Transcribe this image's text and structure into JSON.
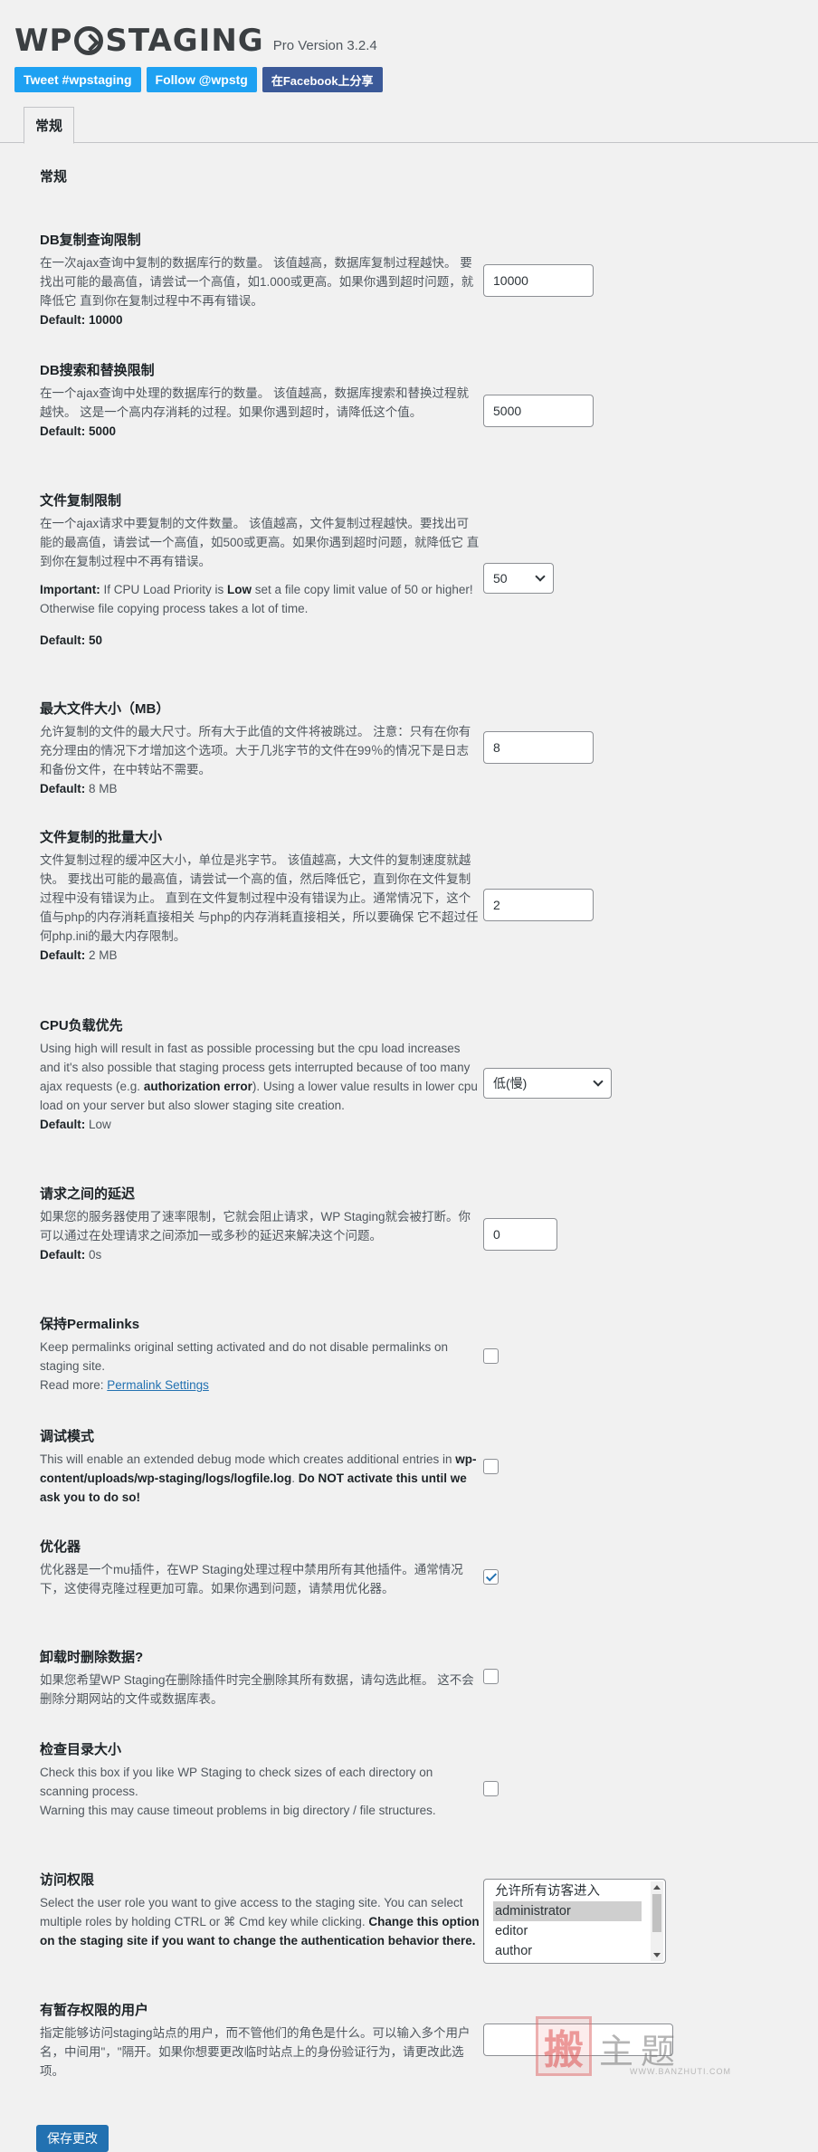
{
  "header": {
    "logo_text_left": "WP",
    "logo_text_right": "STAGING",
    "version": "Pro Version 3.2.4",
    "social": {
      "tweet": "Tweet #wpstaging",
      "follow": "Follow @wpstg",
      "facebook": "在Facebook上分享"
    },
    "tab": "常规"
  },
  "section_title": "常规",
  "settings": {
    "db_copy_limit": {
      "title": "DB复制查询限制",
      "desc": "在一次ajax查询中复制的数据库行的数量。 该值越高，数据库复制过程越快。 要找出可能的最高值，请尝试一个高值，如1.000或更高。如果你遇到超时问题，就降低它 直到你在复制过程中不再有错误。",
      "default_label": "Default:",
      "default_value": "10000",
      "value": "10000"
    },
    "db_search_replace": {
      "title": "DB搜索和替换限制",
      "desc": "在一个ajax查询中处理的数据库行的数量。 该值越高，数据库搜索和替换过程就越快。 这是一个高内存消耗的过程。如果你遇到超时，请降低这个值。",
      "default_label": "Default:",
      "default_value": "5000",
      "value": "5000"
    },
    "file_copy_limit": {
      "title": "文件复制限制",
      "desc": "在一个ajax请求中要复制的文件数量。 该值越高，文件复制过程越快。要找出可能的最高值，请尝试一个高值，如500或更高。如果你遇到超时问题，就降低它 直到你在复制过程中不再有错误。",
      "important_label": "Important:",
      "important_a": " If CPU Load Priority is ",
      "important_low": "Low",
      "important_b": " set a file copy limit value of 50 or higher! Otherwise file copying process takes a lot of time.",
      "default_label": "Default: 50",
      "value": "50"
    },
    "max_file_size": {
      "title": "最大文件大小（MB）",
      "desc": "允许复制的文件的最大尺寸。所有大于此值的文件将被跳过。 注意：只有在你有充分理由的情况下才增加这个选项。大于几兆字节的文件在99％的情况下是日志和备份文件，在中转站不需要。",
      "default_label": "Default:",
      "default_value": " 8 MB",
      "value": "8"
    },
    "file_batch_size": {
      "title": "文件复制的批量大小",
      "desc": "文件复制过程的缓冲区大小，单位是兆字节。 该值越高，大文件的复制速度就越快。 要找出可能的最高值，请尝试一个高的值，然后降低它，直到你在文件复制过程中没有错误为止。 直到在文件复制过程中没有错误为止。通常情况下，这个值与php的内存消耗直接相关 与php的内存消耗直接相关，所以要确保 它不超过任何php.ini的最大内存限制。",
      "default_label": "Default:",
      "default_value": " 2 MB",
      "value": "2"
    },
    "cpu_load": {
      "title": "CPU负载优先",
      "desc_a": "Using high will result in fast as possible processing but the cpu load increases and it's also possible that staging process gets interrupted because of too many ajax requests (e.g. ",
      "desc_b": "authorization error",
      "desc_c": "). Using a lower value results in lower cpu load on your server but also slower staging site creation.",
      "default_label": "Default:",
      "default_value": " Low",
      "value": "低(慢)"
    },
    "delay": {
      "title": "请求之间的延迟",
      "desc": "如果您的服务器使用了速率限制，它就会阻止请求，WP Staging就会被打断。你可以通过在处理请求之间添加一或多秒的延迟来解决这个问题。",
      "default_label": "Default:",
      "default_value": " 0s",
      "value": "0"
    },
    "permalinks": {
      "title": "保持Permalinks",
      "desc": "Keep permalinks original setting activated and do not disable permalinks on staging site.",
      "read_more": "Read more: ",
      "link": "Permalink Settings"
    },
    "debug": {
      "title": "调试模式",
      "desc_a": "This will enable an extended debug mode which creates additional entries in ",
      "path": "wp-content/uploads/wp-staging/logs/logfile.log",
      "desc_b": ". ",
      "warn": "Do NOT activate this until we ask you to do so!"
    },
    "optimizer": {
      "title": "优化器",
      "desc": "优化器是一个mu插件，在WP Staging处理过程中禁用所有其他插件。通常情况下，这使得克隆过程更加可靠。如果你遇到问题，请禁用优化器。"
    },
    "uninstall": {
      "title": "卸载时删除数据?",
      "desc": "如果您希望WP Staging在删除插件时完全删除其所有数据，请勾选此框。 这不会删除分期网站的文件或数据库表。"
    },
    "dir_size": {
      "title": "检查目录大小",
      "desc": "Check this box if you like WP Staging to check sizes of each directory on scanning process.",
      "warn": "Warning this may cause timeout problems in big directory / file structures."
    },
    "access": {
      "title": "访问权限",
      "desc_a": "Select the user role you want to give access to the staging site. You can select multiple roles by holding CTRL or ⌘ Cmd key while clicking. ",
      "desc_b": "Change this option on the staging site if you want to change the authentication behavior there.",
      "options": [
        "允许所有访客进入",
        "administrator",
        "editor",
        "author"
      ]
    },
    "users": {
      "title": "有暂存权限的用户",
      "desc": "指定能够访问staging站点的用户，而不管他们的角色是什么。可以输入多个用户名，中间用\"，\"隔开。如果你想要更改临时站点上的身份验证行为，请更改此选项。",
      "value": ""
    }
  },
  "save_button": "保存更改",
  "watermark": {
    "char1": "搬",
    "chars": "主题",
    "url": "WWW.BANZHUTI.COM"
  }
}
